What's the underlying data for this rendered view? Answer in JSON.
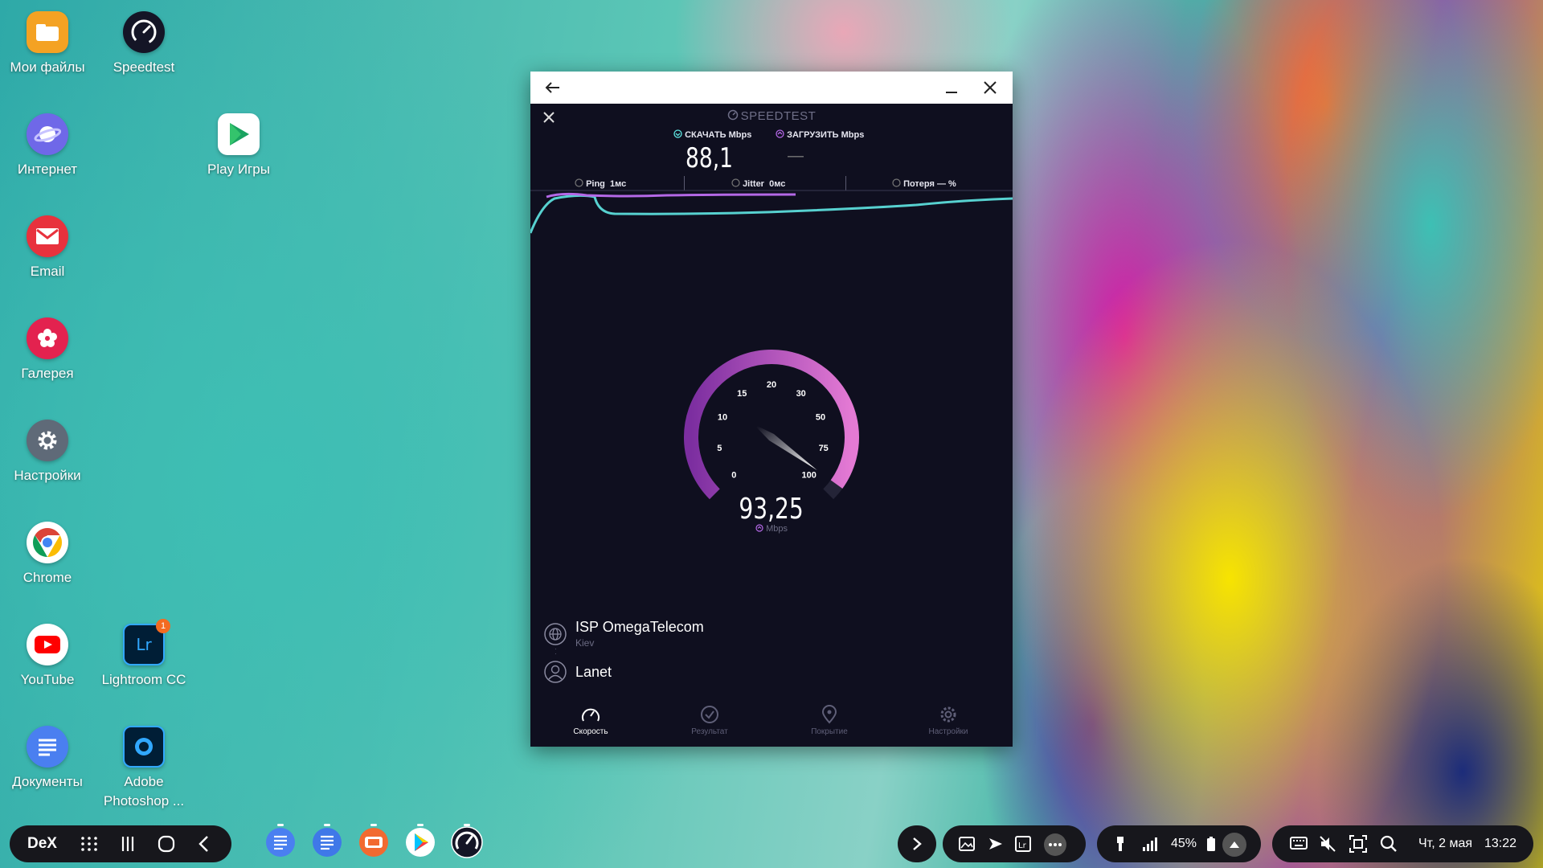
{
  "desktop": {
    "icons": [
      {
        "label": "Мои файлы",
        "icon": "folder-icon"
      },
      {
        "label": "Speedtest",
        "icon": "speedometer-icon"
      },
      {
        "label": "Интернет",
        "icon": "planet-icon"
      },
      {
        "label": "Play Игры",
        "icon": "play-games-icon"
      },
      {
        "label": "Email",
        "icon": "envelope-icon"
      },
      {
        "label": "Галерея",
        "icon": "flower-icon"
      },
      {
        "label": "Настройки",
        "icon": "gear-icon"
      },
      {
        "label": "Chrome",
        "icon": "chrome-icon"
      },
      {
        "label": "YouTube",
        "icon": "youtube-icon"
      },
      {
        "label": "Lightroom CC",
        "icon": "lightroom-icon",
        "badge": "1"
      },
      {
        "label": "Документы",
        "icon": "document-icon"
      },
      {
        "label": "Adobe Photoshop ...",
        "icon": "photoshop-icon"
      }
    ]
  },
  "window": {
    "app_name": "SPEEDTEST",
    "download_label": "СКАЧАТЬ Mbps",
    "upload_label": "ЗАГРУЗИТЬ Mbps",
    "download_value": "88,1",
    "upload_value": "—",
    "ping_label": "Ping",
    "ping_value": "1мс",
    "jitter_label": "Jitter",
    "jitter_value": "0мс",
    "loss_label": "Потеря",
    "loss_value": "— %",
    "gauge": {
      "ticks": [
        "0",
        "5",
        "10",
        "15",
        "20",
        "30",
        "50",
        "75",
        "100"
      ],
      "value": "93,25",
      "unit": "Mbps",
      "current_mbps": 93.25
    },
    "isp_name": "ISP OmegaTelecom",
    "isp_city": "Kiev",
    "server_name": "Lanet",
    "nav": [
      {
        "label": "Скорость",
        "icon": "speed-icon",
        "active": true
      },
      {
        "label": "Результат",
        "icon": "check-icon",
        "active": false
      },
      {
        "label": "Покрытие",
        "icon": "location-pin-icon",
        "active": false
      },
      {
        "label": "Настройки",
        "icon": "settings-icon",
        "active": false
      }
    ],
    "colors": {
      "download": "#5fe7e3",
      "upload": "#b468e6",
      "background": "#0f0f1f"
    }
  },
  "taskbar": {
    "dex_label": "DeX",
    "battery": "45%",
    "date": "Чт, 2 мая",
    "time": "13:22"
  }
}
